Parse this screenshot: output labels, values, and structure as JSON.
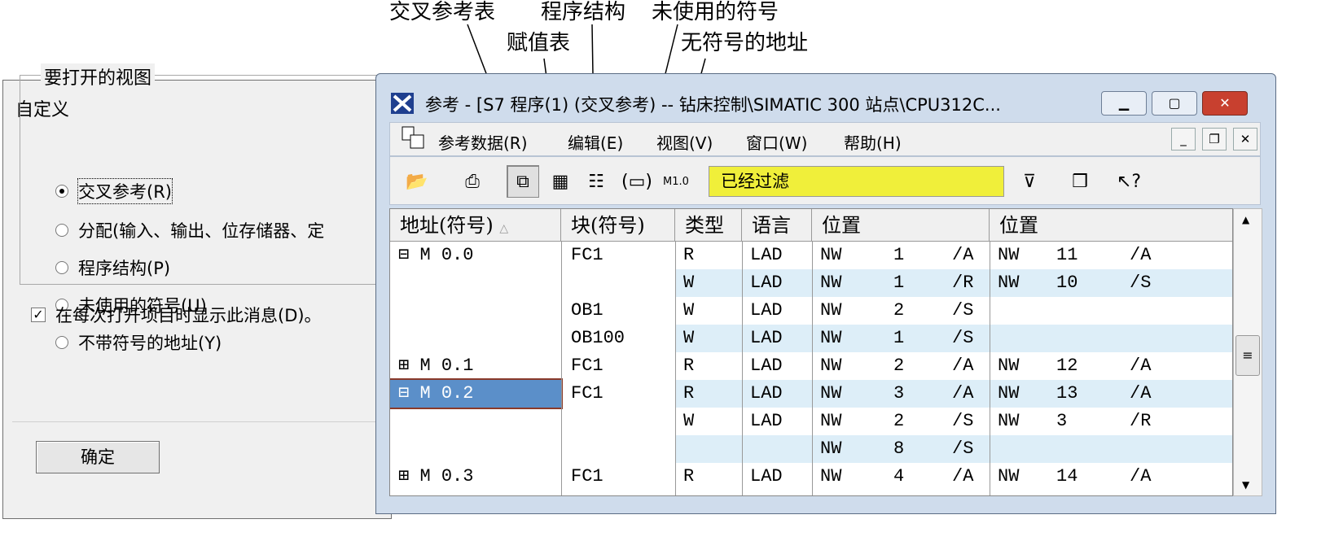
{
  "annotations": {
    "cross_ref": "交叉参考表",
    "prog_struct": "程序结构",
    "unused": "未使用的符号",
    "assign": "赋值表",
    "no_symbol": "无符号的地址"
  },
  "dialog": {
    "title": "自定义",
    "group": "要打开的视图",
    "options": [
      "交叉参考(R)",
      "分配(输入、输出、位存储器、定",
      "程序结构(P)",
      "未使用的符号(U)",
      "不带符号的地址(Y)"
    ],
    "checkbox": "在每次打开项目时显示此消息(D)。",
    "ok": "确定"
  },
  "window": {
    "title": "参考 - [S7 程序(1) (交叉参考) -- 钻床控制\\SIMATIC 300 站点\\CPU312C...",
    "menu": [
      "参考数据(R)",
      "编辑(E)",
      "视图(V)",
      "窗口(W)",
      "帮助(H)"
    ],
    "filter": "已经过滤"
  },
  "grid": {
    "headers": [
      "地址(符号)",
      "块(符号)",
      "类型",
      "语言",
      "位置",
      "位置"
    ],
    "rows": [
      [
        "⊟ M 0.0",
        "FC1",
        "R",
        "LAD",
        "NW",
        "1",
        "/A",
        "NW",
        "11",
        "/A"
      ],
      [
        "",
        "",
        "W",
        "LAD",
        "NW",
        "1",
        "/R",
        "NW",
        "10",
        "/S"
      ],
      [
        "",
        "OB1",
        "W",
        "LAD",
        "NW",
        "2",
        "/S",
        "",
        "",
        ""
      ],
      [
        "",
        "OB100",
        "W",
        "LAD",
        "NW",
        "1",
        "/S",
        "",
        "",
        ""
      ],
      [
        "⊞ M 0.1",
        "FC1",
        "R",
        "LAD",
        "NW",
        "2",
        "/A",
        "NW",
        "12",
        "/A"
      ],
      [
        "⊟ M 0.2",
        "FC1",
        "R",
        "LAD",
        "NW",
        "3",
        "/A",
        "NW",
        "13",
        "/A"
      ],
      [
        "",
        "",
        "W",
        "LAD",
        "NW",
        "2",
        "/S",
        "NW",
        "3",
        "/R"
      ],
      [
        "",
        "",
        "",
        "",
        "NW",
        "8",
        "/S",
        "",
        "",
        ""
      ],
      [
        "⊞ M 0.3",
        "FC1",
        "R",
        "LAD",
        "NW",
        "4",
        "/A",
        "NW",
        "14",
        "/A"
      ]
    ]
  }
}
